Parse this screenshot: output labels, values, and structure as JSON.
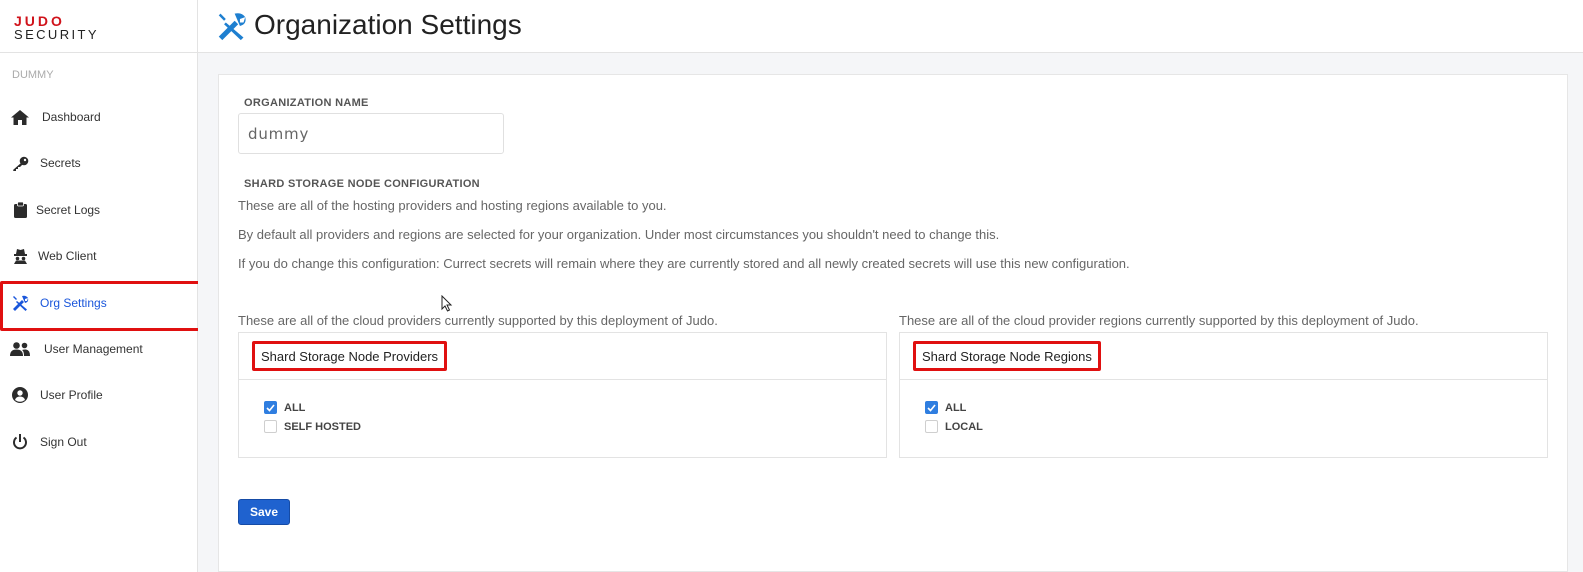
{
  "logo": {
    "line1": "JUDO",
    "line2": "SECURITY"
  },
  "sidebar": {
    "org_name": "DUMMY",
    "items": [
      {
        "label": "Dashboard",
        "icon": "home-icon"
      },
      {
        "label": "Secrets",
        "icon": "key-icon"
      },
      {
        "label": "Secret Logs",
        "icon": "clipboard-icon"
      },
      {
        "label": "Web Client",
        "icon": "incognito-icon"
      },
      {
        "label": "Org Settings",
        "icon": "tools-icon",
        "active": true
      },
      {
        "label": "User Management",
        "icon": "users-icon"
      },
      {
        "label": "User Profile",
        "icon": "user-circle-icon"
      },
      {
        "label": "Sign Out",
        "icon": "power-icon"
      }
    ]
  },
  "header": {
    "title": "Organization Settings",
    "icon": "tools-icon"
  },
  "form": {
    "org_name_label": "ORGANIZATION NAME",
    "org_name_value": "dummy",
    "shard_label": "SHARD STORAGE NODE CONFIGURATION",
    "para1": "These are all of the hosting providers and hosting regions available to you.",
    "para2": "By default all providers and regions are selected for your organization. Under most circumstances you shouldn't need to change this.",
    "para3": "If you do change this configuration: Currect secrets will remain where they are currently stored and all newly created secrets will use this new configuration.",
    "providers": {
      "caption": "These are all of the cloud providers currently supported by this deployment of Judo.",
      "title": "Shard Storage Node Providers",
      "options": [
        {
          "label": "ALL",
          "checked": true
        },
        {
          "label": "SELF HOSTED",
          "checked": false
        }
      ]
    },
    "regions": {
      "caption": "These are all of the cloud provider regions currently supported by this deployment of Judo.",
      "title": "Shard Storage Node Regions",
      "options": [
        {
          "label": "ALL",
          "checked": true
        },
        {
          "label": "LOCAL",
          "checked": false
        }
      ]
    },
    "save_label": "Save"
  },
  "colors": {
    "accent": "#1f62cf",
    "highlight": "#e01010",
    "brand_red": "#d0131b",
    "checkbox": "#2f7ee0"
  }
}
